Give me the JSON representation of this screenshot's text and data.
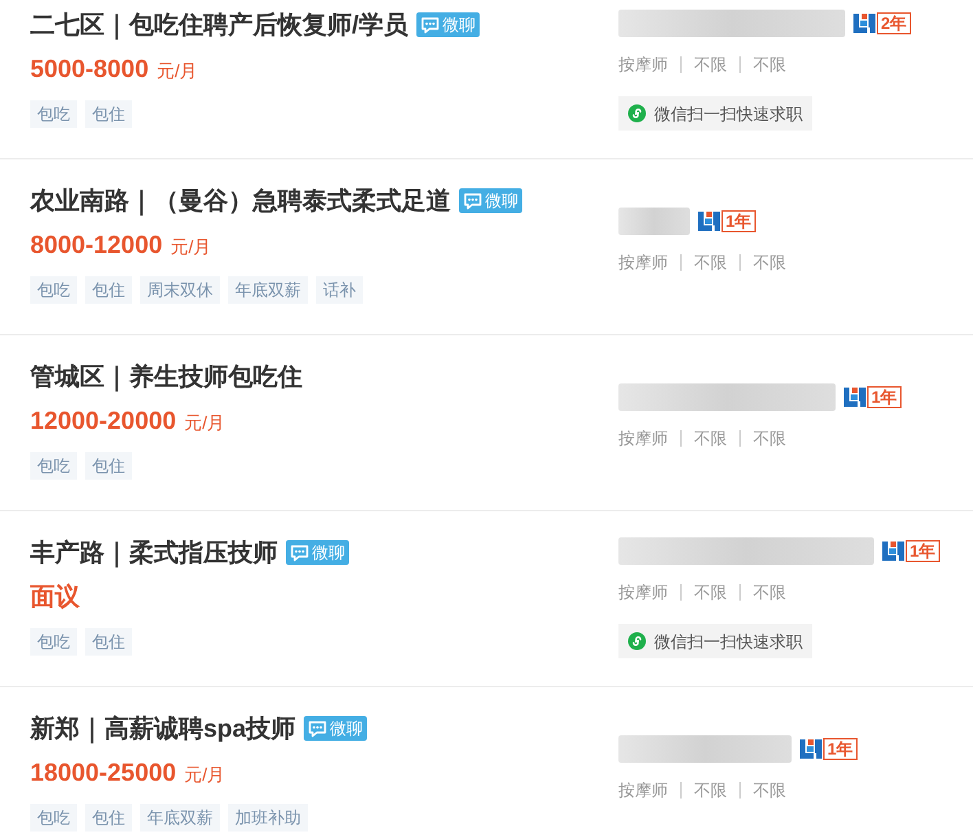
{
  "listings": [
    {
      "title": "二七区｜包吃住聘产后恢复师/学员",
      "chat_badge": "微聊",
      "salary": "5000-8000",
      "salary_unit": "元/月",
      "tags": [
        "包吃",
        "包住"
      ],
      "member_years": "2年",
      "meta": [
        "按摩师",
        "不限",
        "不限"
      ],
      "wechat_apply": "微信扫一扫快速求职"
    },
    {
      "title": "农业南路｜（曼谷）急聘泰式柔式足道",
      "chat_badge": "微聊",
      "salary": "8000-12000",
      "salary_unit": "元/月",
      "tags": [
        "包吃",
        "包住",
        "周末双休",
        "年底双薪",
        "话补"
      ],
      "member_years": "1年",
      "meta": [
        "按摩师",
        "不限",
        "不限"
      ]
    },
    {
      "title": "管城区｜养生技师包吃住",
      "salary": "12000-20000",
      "salary_unit": "元/月",
      "tags": [
        "包吃",
        "包住"
      ],
      "member_years": "1年",
      "meta": [
        "按摩师",
        "不限",
        "不限"
      ]
    },
    {
      "title": "丰产路｜柔式指压技师",
      "chat_badge": "微聊",
      "salary": "面议",
      "tags": [
        "包吃",
        "包住"
      ],
      "member_years": "1年",
      "meta": [
        "按摩师",
        "不限",
        "不限"
      ],
      "wechat_apply": "微信扫一扫快速求职"
    },
    {
      "title": "新郑｜高薪诚聘spa技师",
      "chat_badge": "微聊",
      "salary": "18000-25000",
      "salary_unit": "元/月",
      "tags": [
        "包吃",
        "包住",
        "年底双薪",
        "加班补助"
      ],
      "member_years": "1年",
      "meta": [
        "按摩师",
        "不限",
        "不限"
      ]
    }
  ]
}
